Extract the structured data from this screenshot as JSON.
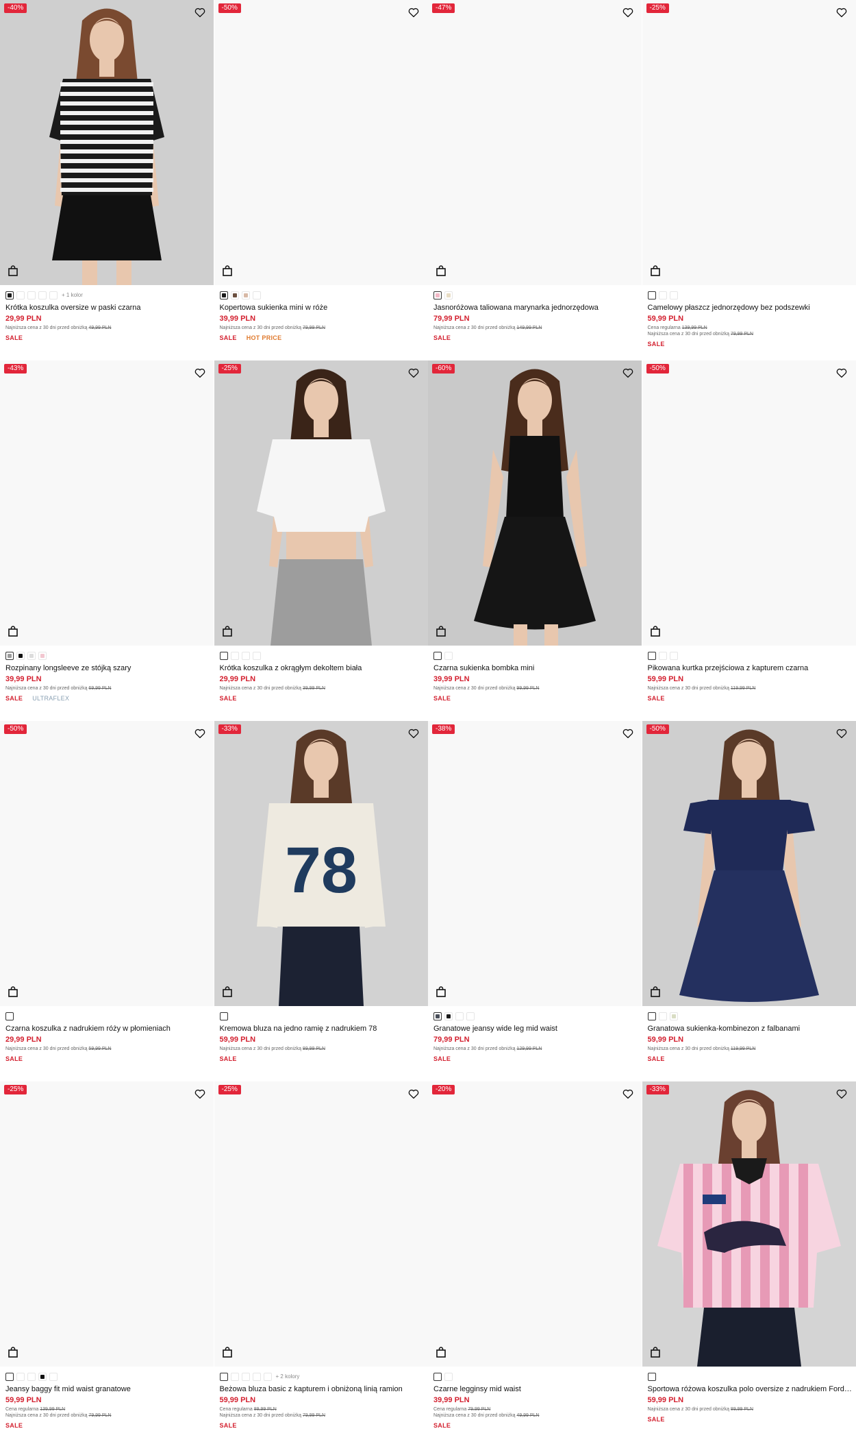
{
  "products": [
    {
      "discount": "-40%",
      "title": "Krótka koszulka oversize w paski czarna",
      "price": "29,99 PLN",
      "regular": "",
      "lowest_label": "Najniższa cena z 30 dni przed obniżką",
      "lowest": "49,99 PLN",
      "badge1": "SALE",
      "badge2": "",
      "more": "+ 1 kolor",
      "photo": "stripes",
      "swatches": [
        "#1b1b1b",
        "#ffffff",
        "#ffffff",
        "#ffffff",
        "#ffffff"
      ],
      "sel": 0
    },
    {
      "discount": "-50%",
      "title": "Kopertowa sukienka mini w róże",
      "price": "39,99 PLN",
      "regular": "",
      "lowest_label": "Najniższa cena z 30 dni przed obniżką",
      "lowest": "79,99 PLN",
      "badge1": "SALE",
      "badge2": "HOT PRICE",
      "more": "",
      "photo": "",
      "swatches": [
        "#1b1b1b",
        "#6b5040",
        "#d8b9a6",
        "#ffffff"
      ],
      "sel": 0
    },
    {
      "discount": "-47%",
      "title": "Jasnoróżowa taliowana marynarka jednorzędowa",
      "price": "79,99 PLN",
      "regular": "",
      "lowest_label": "Najniższa cena z 30 dni przed obniżką",
      "lowest": "149,99 PLN",
      "badge1": "SALE",
      "badge2": "",
      "more": "",
      "photo": "",
      "swatches": [
        "#f2b8c6",
        "#e7dcc4"
      ],
      "sel": 0
    },
    {
      "discount": "-25%",
      "title": "Camelowy płaszcz jednorzędowy bez podszewki",
      "price": "59,99 PLN",
      "regular_label": "Cena regularna",
      "regular": "139,99 PLN",
      "lowest_label": "Najniższa cena z 30 dni przed obniżką",
      "lowest": "79,99 PLN",
      "badge1": "SALE",
      "badge2": "",
      "more": "",
      "photo": "",
      "swatches": [
        "#ffffff",
        "#ffffff",
        "#ffffff"
      ],
      "sel": 0
    },
    {
      "discount": "-43%",
      "title": "Rozpinany longsleeve ze stójką szary",
      "price": "39,99 PLN",
      "regular": "",
      "lowest_label": "Najniższa cena z 30 dni przed obniżką",
      "lowest": "69,99 PLN",
      "badge1": "SALE",
      "badge2": "ULTRAFLEX",
      "more": "",
      "photo": "",
      "swatches": [
        "#9c9c9c",
        "#111111",
        "#dcdcdc",
        "#f2c7d0"
      ],
      "sel": 0
    },
    {
      "discount": "-25%",
      "title": "Krótka koszulka z okrągłym dekoltem biała",
      "price": "29,99 PLN",
      "regular": "",
      "lowest_label": "Najniższa cena z 30 dni przed obniżką",
      "lowest": "39,99 PLN",
      "badge1": "SALE",
      "badge2": "",
      "more": "",
      "photo": "whitecrop",
      "swatches": [
        "#ffffff",
        "#ffffff",
        "#ffffff",
        "#ffffff"
      ],
      "sel": 0
    },
    {
      "discount": "-60%",
      "title": "Czarna sukienka bombka mini",
      "price": "39,99 PLN",
      "regular": "",
      "lowest_label": "Najniższa cena z 30 dni przed obniżką",
      "lowest": "99,99 PLN",
      "badge1": "SALE",
      "badge2": "",
      "more": "",
      "photo": "blackdress",
      "swatches": [
        "#ffffff",
        "#ffffff"
      ],
      "sel": 0
    },
    {
      "discount": "-50%",
      "title": "Pikowana kurtka przejściowa z kapturem czarna",
      "price": "59,99 PLN",
      "regular": "",
      "lowest_label": "Najniższa cena z 30 dni przed obniżką",
      "lowest": "119,99 PLN",
      "badge1": "SALE",
      "badge2": "",
      "more": "",
      "photo": "",
      "swatches": [
        "#ffffff",
        "#ffffff",
        "#ffffff"
      ],
      "sel": 0
    },
    {
      "discount": "-50%",
      "title": "Czarna koszulka z nadrukiem róży w płomieniach",
      "price": "29,99 PLN",
      "regular": "",
      "lowest_label": "Najniższa cena z 30 dni przed obniżką",
      "lowest": "59,99 PLN",
      "badge1": "SALE",
      "badge2": "",
      "more": "",
      "photo": "",
      "swatches": [
        "#ffffff"
      ],
      "sel": 0
    },
    {
      "discount": "-33%",
      "title": "Kremowa bluza na jedno ramię z nadrukiem 78",
      "price": "59,99 PLN",
      "regular": "",
      "lowest_label": "Najniższa cena z 30 dni przed obniżką",
      "lowest": "89,99 PLN",
      "badge1": "SALE",
      "badge2": "",
      "more": "",
      "photo": "sweat78",
      "swatches": [
        "#ffffff"
      ],
      "sel": 0
    },
    {
      "discount": "-38%",
      "title": "Granatowe jeansy wide leg mid waist",
      "price": "79,99 PLN",
      "regular": "",
      "lowest_label": "Najniższa cena z 30 dni przed obniżką",
      "lowest": "129,99 PLN",
      "badge1": "SALE",
      "badge2": "",
      "more": "",
      "photo": "",
      "swatches": [
        "#4a4f5a",
        "#1b1b1b",
        "#ffffff",
        "#ffffff"
      ],
      "sel": 0
    },
    {
      "discount": "-50%",
      "title": "Granatowa sukienka-kombinezon z falbanami",
      "price": "59,99 PLN",
      "regular": "",
      "lowest_label": "Najniższa cena z 30 dni przed obniżką",
      "lowest": "119,99 PLN",
      "badge1": "SALE",
      "badge2": "",
      "more": "",
      "photo": "navydress",
      "swatches": [
        "#ffffff",
        "#ffffff",
        "#d9ddc4"
      ],
      "sel": 0
    },
    {
      "discount": "-25%",
      "title": "Jeansy baggy fit mid waist granatowe",
      "price": "59,99 PLN",
      "regular_label": "Cena regularna",
      "regular": "139,99 PLN",
      "lowest_label": "Najniższa cena z 30 dni przed obniżką",
      "lowest": "79,99 PLN",
      "badge1": "SALE",
      "badge2": "",
      "more": "",
      "photo": "",
      "swatches": [
        "#ffffff",
        "#ffffff",
        "#ffffff",
        "#111111",
        "#ffffff"
      ],
      "sel": 0
    },
    {
      "discount": "-25%",
      "title": "Beżowa bluza basic z kapturem i obniżoną linią ramion",
      "price": "59,99 PLN",
      "regular_label": "Cena regularna",
      "regular": "89,99 PLN",
      "lowest_label": "Najniższa cena z 30 dni przed obniżką",
      "lowest": "79,99 PLN",
      "badge1": "SALE",
      "badge2": "",
      "more": "+ 2 kolory",
      "photo": "",
      "swatches": [
        "#ffffff",
        "#ffffff",
        "#ffffff",
        "#ffffff",
        "#ffffff"
      ],
      "sel": 0
    },
    {
      "discount": "-20%",
      "title": "Czarne legginsy mid waist",
      "price": "39,99 PLN",
      "regular_label": "Cena regularna",
      "regular": "79,99 PLN",
      "lowest_label": "Najniższa cena z 30 dni przed obniżką",
      "lowest": "49,99 PLN",
      "badge1": "SALE",
      "badge2": "",
      "more": "",
      "photo": "",
      "swatches": [
        "#ffffff",
        "#ffffff"
      ],
      "sel": 0
    },
    {
      "discount": "-33%",
      "title": "Sportowa różowa koszulka polo oversize z nadrukiem Ford Mustang",
      "price": "59,99 PLN",
      "regular": "",
      "lowest_label": "Najniższa cena z 30 dni przed obniżką",
      "lowest": "89,99 PLN",
      "badge1": "SALE",
      "badge2": "",
      "more": "",
      "photo": "pinkpolo",
      "swatches": [
        "#ffffff"
      ],
      "sel": 0
    }
  ],
  "colors": {
    "accent": "#e2263a",
    "price": "#d3202f",
    "hot": "#e07a2e",
    "ultraflex": "#8aa0b3"
  },
  "icons": {
    "heart": "heart-icon",
    "bag": "shopping-bag-icon"
  }
}
